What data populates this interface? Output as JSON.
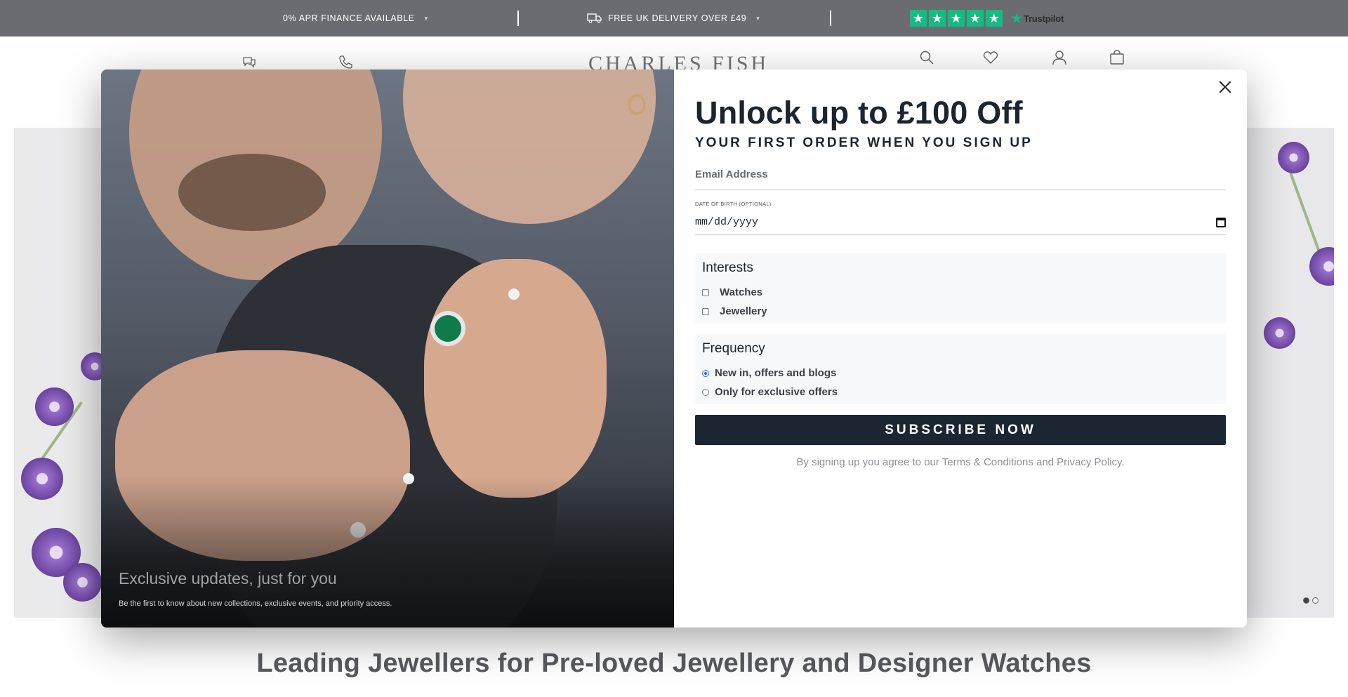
{
  "topbar": {
    "finance_text": "0% APR FINANCE AVAILABLE",
    "delivery_text": "FREE UK DELIVERY OVER £49",
    "trustpilot_label": "Trustpilot",
    "star_count": 5,
    "background_color": "#5f6066",
    "trustpilot_color": "#00b67a"
  },
  "header": {
    "brand_name": "CHARLES FISH",
    "icons": [
      "chat-icon",
      "phone-icon",
      "search-icon",
      "heart-icon",
      "account-icon",
      "bag-icon"
    ]
  },
  "hero": {
    "slide_count": 2,
    "active_slide": 1
  },
  "section": {
    "heading": "Leading Jewellers for Pre-loved Jewellery and Designer Watches"
  },
  "modal": {
    "photo_caption_title": "Exclusive updates, just for you",
    "photo_caption_sub": "Be the first to know about new collections, exclusive events, and priority access.",
    "title": "Unlock up to £100 Off",
    "subtitle": "YOUR FIRST ORDER WHEN YOU SIGN UP",
    "email_placeholder": "Email Address",
    "dob_label": "DATE OF BIRTH (OPTIONAL)",
    "dob_value": "mm/dd/yyyy",
    "interests": {
      "title": "Interests",
      "options": [
        "Watches",
        "Jewellery"
      ]
    },
    "frequency": {
      "title": "Frequency",
      "options": [
        "New in, offers and blogs",
        "Only for exclusive offers"
      ],
      "selected": "New in, offers and blogs"
    },
    "subscribe_label": "SUBSCRIBE NOW",
    "terms_text": "By signing up you agree to our Terms & Conditions and Privacy Policy.",
    "button_color": "#1c2633"
  }
}
